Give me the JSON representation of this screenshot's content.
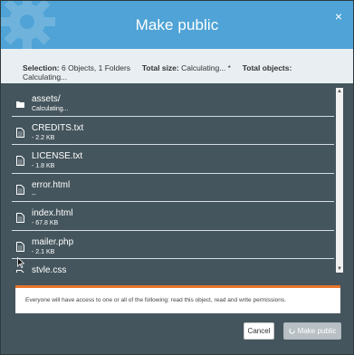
{
  "dialog": {
    "title": "Make public",
    "close_glyph": "×",
    "icons": {
      "header_decor": "gear-icon",
      "close": "close-icon"
    }
  },
  "summary": {
    "selection_label": "Selection:",
    "selection_value": "6 Objects, 1 Folders",
    "total_size_label": "Total size:",
    "total_size_value": "Calculating... *",
    "total_objects_label": "Total objects:",
    "total_objects_value": "Calculating..."
  },
  "items": [
    {
      "name": "assets/",
      "sub": "Calculating...",
      "icon": "folder-icon"
    },
    {
      "name": "CREDITS.txt",
      "sub": "- 2.2 KB",
      "icon": "file-icon"
    },
    {
      "name": "LICENSE.txt",
      "sub": "- 1.8 KB",
      "icon": "file-icon"
    },
    {
      "name": "error.html",
      "sub": "--",
      "icon": "file-icon"
    },
    {
      "name": "index.html",
      "sub": "- 67.8 KB",
      "icon": "file-icon"
    },
    {
      "name": "mailer.php",
      "sub": "- 2.1 KB",
      "icon": "file-icon"
    },
    {
      "name": "style.css",
      "sub": "",
      "icon": "file-icon"
    }
  ],
  "notice": {
    "text": "Everyone will have access to one or all of the following: read this object, read and write permissions.",
    "accent_color": "#e8752b"
  },
  "buttons": {
    "cancel_label": "Cancel",
    "make_public_label": "Make public"
  },
  "colors": {
    "header": "#4fa3d6",
    "summary_bg": "#e8eef2",
    "list_bg": "#44555d"
  }
}
